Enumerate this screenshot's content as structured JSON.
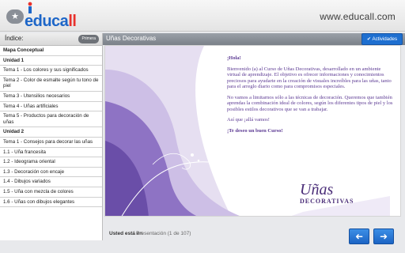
{
  "header": {
    "star_icon": "star-icon",
    "logo_text_main": "educa",
    "logo_text_accent": "ll",
    "url": "www.educall.com"
  },
  "sidebar": {
    "index_title": "Índice:",
    "print_label": "Primera",
    "items": [
      {
        "label": "Mapa Conceptual",
        "type": "current"
      },
      {
        "label": "Unidad 1",
        "type": "unit"
      },
      {
        "label": "Tema 1 - Los colores y sus significados",
        "type": "topic"
      },
      {
        "label": "Tema 2 - Color de esmalte según tu tono de piel",
        "type": "topic"
      },
      {
        "label": "Tema 3 - Utensilios necesarios",
        "type": "topic"
      },
      {
        "label": "Tema 4 - Uñas artificiales",
        "type": "topic"
      },
      {
        "label": "Tema 5 - Productos para decoración de uñas",
        "type": "topic"
      },
      {
        "label": "Unidad 2",
        "type": "unit"
      },
      {
        "label": "Tema 1 - Consejos para decorar las uñas",
        "type": "topic"
      },
      {
        "label": "1.1 - Uña francesita",
        "type": "topic"
      },
      {
        "label": "1.2 - Ideograma oriental",
        "type": "topic"
      },
      {
        "label": "1.3 - Decoración con encaje",
        "type": "topic"
      },
      {
        "label": "1.4 - Dibujos variados",
        "type": "topic"
      },
      {
        "label": "1.5 - Uña con mezcla de colores",
        "type": "topic"
      },
      {
        "label": "1.6 - Uñas con dibujos elegantes",
        "type": "topic"
      }
    ]
  },
  "topic_bar": {
    "title": "Uñas Decorativas",
    "activities_label": "Actividades"
  },
  "content": {
    "greeting": "¡Hola!",
    "para1": "Bienvenido (a) al Curso de Uñas Decorativas, desarrollado en un ambiente virtual de aprendizaje. El objetivo es ofrecer informaciones y conocimientos preciosos para ayudarte en la creación de visuales increíbles para las uñas, tanto para el arreglo diario como para compromisos especiales.",
    "para2": "No vamos a limitarnos sólo a las técnicas de decoración. Queremos que también aprendas la combinación ideal de colores, según los diferentes tipos de piel y los posibles estilos decorativos que se van a trabajar.",
    "para3": "Así que ¡allá vamos!",
    "closing": "¡Te deseo un buen Curso!",
    "brand_line1": "Uñas",
    "brand_line2": "DECORATIVAS"
  },
  "footer": {
    "label": "Usted está en",
    "value": "Presentación (1 de 107)",
    "prev_icon": "arrow-left-icon",
    "next_icon": "arrow-right-icon"
  },
  "colors": {
    "accent": "#1e6fd0",
    "purple": "#5c3a93",
    "logo_red": "#e8322d"
  }
}
